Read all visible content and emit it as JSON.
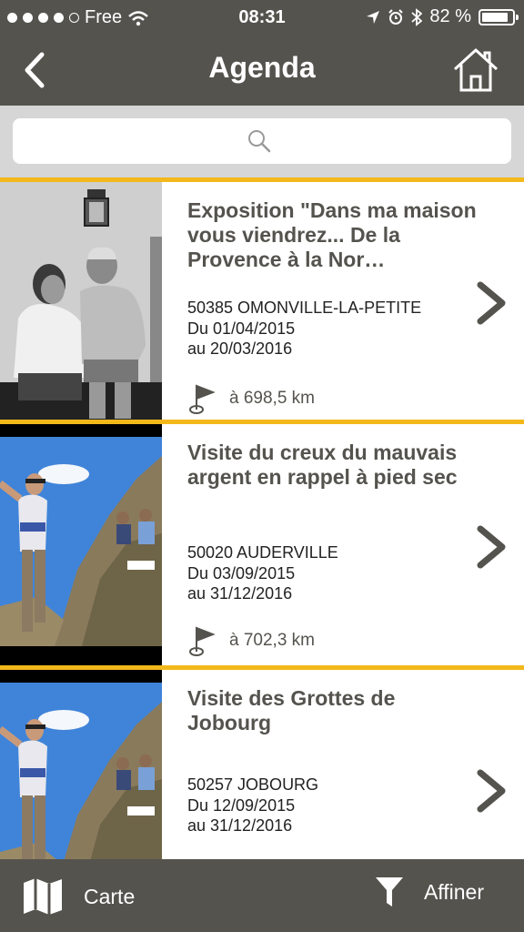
{
  "status": {
    "carrier": "Free",
    "time": "08:31",
    "battery": "82 %"
  },
  "nav": {
    "title": "Agenda"
  },
  "search": {
    "placeholder": ""
  },
  "items": [
    {
      "title": "Exposition \"Dans ma maison vous viendrez... De la Provence à la Nor…",
      "address": "50385 OMONVILLE-LA-PETITE",
      "from": "Du 01/04/2015",
      "to": "au 20/03/2016",
      "distance": "à 698,5 km"
    },
    {
      "title": "Visite du creux du mauvais argent en rappel à pied sec",
      "address": "50020 AUDERVILLE",
      "from": "Du 03/09/2015",
      "to": "au 31/12/2016",
      "distance": "à 702,3 km"
    },
    {
      "title": "Visite des Grottes de Jobourg",
      "address": "50257 JOBOURG",
      "from": "Du 12/09/2015",
      "to": "au 31/12/2016",
      "distance": ""
    }
  ],
  "tabbar": {
    "map_label": "Carte",
    "filter_label": "Affiner"
  },
  "colors": {
    "bar": "#55534e",
    "accent": "#f3b81a",
    "search_bg": "#d6d6d6"
  }
}
